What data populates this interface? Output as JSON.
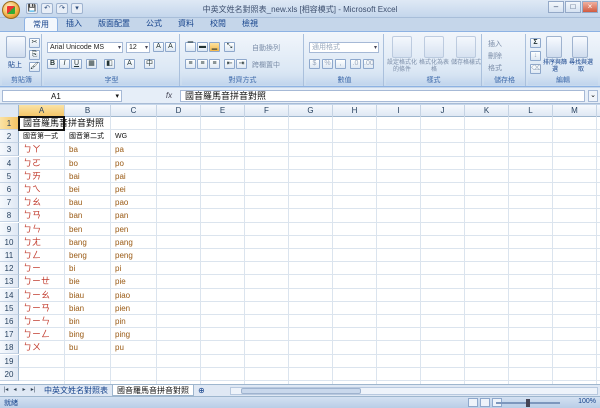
{
  "window": {
    "title": "中英文姓名對照表_new.xls [相容模式] - Microsoft Excel",
    "controls": [
      "–",
      "□",
      "×"
    ]
  },
  "qat": [
    "💾",
    "↶",
    "↷",
    "▾"
  ],
  "tabs": [
    {
      "label": "常用",
      "active": true
    },
    {
      "label": "插入"
    },
    {
      "label": "版面配置"
    },
    {
      "label": "公式"
    },
    {
      "label": "資料"
    },
    {
      "label": "校閱"
    },
    {
      "label": "檢視"
    }
  ],
  "ribbon": {
    "clipboard": {
      "label": "剪貼簿",
      "paste": "貼上"
    },
    "font": {
      "label": "字型",
      "name": "Arial Unicode MS",
      "size": "12"
    },
    "alignment": {
      "label": "對齊方式",
      "wrap": "自動換列",
      "merge": "跨欄置中"
    },
    "number": {
      "label": "數值",
      "format": "通用格式",
      "currency": "$",
      "percent": "%",
      "comma": ","
    },
    "styles": {
      "label": "樣式",
      "cond": "設定格式化的條件",
      "table": "格式化為表格",
      "cell": "儲存格樣式"
    },
    "cells": {
      "label": "儲存格",
      "insert": "插入",
      "delete": "刪除",
      "format": "格式"
    },
    "editing": {
      "label": "編輯",
      "sum": "Σ",
      "sort": "排序與篩選",
      "find": "尋找與選取"
    }
  },
  "formula_bar": {
    "name_box": "A1",
    "fx": "fx",
    "content": "國音羅馬音拼音對照"
  },
  "columns": [
    "A",
    "B",
    "C",
    "D",
    "E",
    "F",
    "G",
    "H",
    "I",
    "J",
    "K",
    "L",
    "M"
  ],
  "selected_column": "A",
  "selected_row": "1",
  "rows": [
    {
      "n": "1",
      "a": "國音羅馬音拼音對照",
      "b": "",
      "c": ""
    },
    {
      "n": "2",
      "a": "國音第一式",
      "b": "國音第二式",
      "c": "WG"
    },
    {
      "n": "3",
      "a": "ㄅㄚ",
      "b": "ba",
      "c": "pa"
    },
    {
      "n": "4",
      "a": "ㄅㄛ",
      "b": "bo",
      "c": "po"
    },
    {
      "n": "5",
      "a": "ㄅㄞ",
      "b": "bai",
      "c": "pai"
    },
    {
      "n": "6",
      "a": "ㄅㄟ",
      "b": "bei",
      "c": "pei"
    },
    {
      "n": "7",
      "a": "ㄅㄠ",
      "b": "bau",
      "c": "pao"
    },
    {
      "n": "8",
      "a": "ㄅㄢ",
      "b": "ban",
      "c": "pan"
    },
    {
      "n": "9",
      "a": "ㄅㄣ",
      "b": "ben",
      "c": "pen"
    },
    {
      "n": "10",
      "a": "ㄅㄤ",
      "b": "bang",
      "c": "pang"
    },
    {
      "n": "11",
      "a": "ㄅㄥ",
      "b": "beng",
      "c": "peng"
    },
    {
      "n": "12",
      "a": "ㄅㄧ",
      "b": "bi",
      "c": "pi"
    },
    {
      "n": "13",
      "a": "ㄅㄧㄝ",
      "b": "bie",
      "c": "pie"
    },
    {
      "n": "14",
      "a": "ㄅㄧㄠ",
      "b": "biau",
      "c": "piao"
    },
    {
      "n": "15",
      "a": "ㄅㄧㄢ",
      "b": "bian",
      "c": "pien"
    },
    {
      "n": "16",
      "a": "ㄅㄧㄣ",
      "b": "bin",
      "c": "pin"
    },
    {
      "n": "17",
      "a": "ㄅㄧㄥ",
      "b": "bing",
      "c": "ping"
    },
    {
      "n": "18",
      "a": "ㄅㄨ",
      "b": "bu",
      "c": "pu"
    },
    {
      "n": "19",
      "a": "",
      "b": "",
      "c": ""
    },
    {
      "n": "20",
      "a": "",
      "b": "",
      "c": ""
    }
  ],
  "sheets": [
    {
      "label": "中英文姓名對照表"
    },
    {
      "label": "國音羅馬音拼音對照",
      "active": true
    }
  ],
  "status": {
    "ready": "就緒",
    "zoom": "100%"
  }
}
